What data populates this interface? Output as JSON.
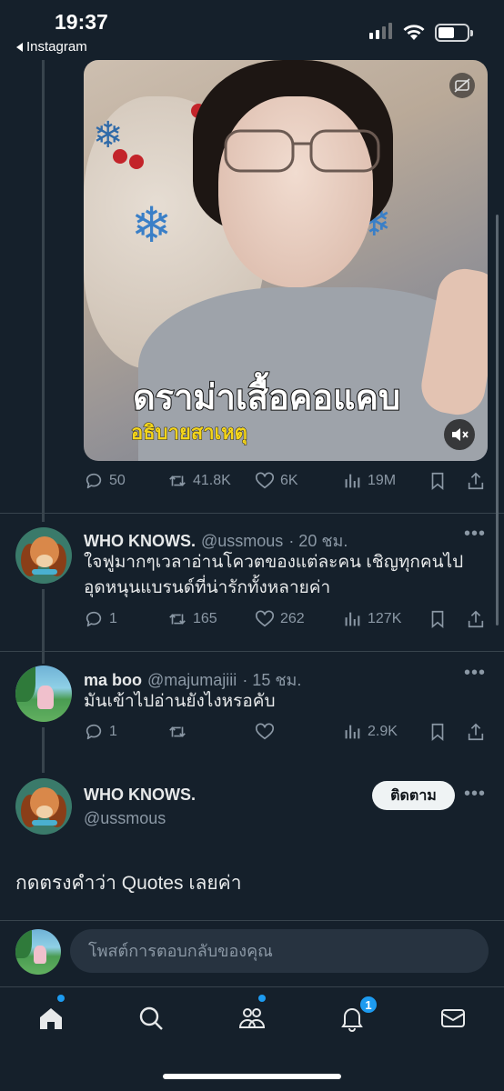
{
  "status_bar": {
    "time": "19:37",
    "back_app": "Instagram"
  },
  "video": {
    "caption_main": "ดราม่าเสื้อคอแคบ",
    "caption_sub": "อธิบายสาเหตุ",
    "icons": [
      "subtitles-off-icon",
      "mute-icon"
    ]
  },
  "video_actions": {
    "replies": "50",
    "reposts": "41.8K",
    "likes": "6K",
    "views": "19M"
  },
  "tweets": [
    {
      "name": "WHO KNOWS.",
      "handle": "@ussmous",
      "time": "· 20 ชม.",
      "text": "ใจฟูมากๆเวลาอ่านโควตของแต่ละคน เชิญทุกคนไปอุดหนุนแบรนด์ที่น่ารักทั้งหลายค่า",
      "replies": "1",
      "reposts": "165",
      "likes": "262",
      "views": "127K"
    },
    {
      "name": "ma boo",
      "handle": "@majumajiii",
      "time": "· 15 ชม.",
      "text": "มันเข้าไปอ่านยังไงหรอคับ",
      "replies": "1",
      "reposts": "",
      "likes": "",
      "views": "2.9K"
    }
  ],
  "profile_card": {
    "name": "WHO KNOWS.",
    "handle": "@ussmous",
    "follow_label": "ติดตาม"
  },
  "quote_prompt": "กดตรงคำว่า Quotes เลยค่า",
  "reply_bar": {
    "placeholder": "โพสต์การตอบกลับของคุณ"
  },
  "tab_bar": {
    "tabs": [
      "home-icon",
      "search-icon",
      "communities-icon",
      "notifications-icon",
      "messages-icon"
    ],
    "notification_count": "1"
  },
  "colors": {
    "background": "#15202b",
    "accent": "#1d9bf0",
    "muted": "#8b98a5"
  }
}
